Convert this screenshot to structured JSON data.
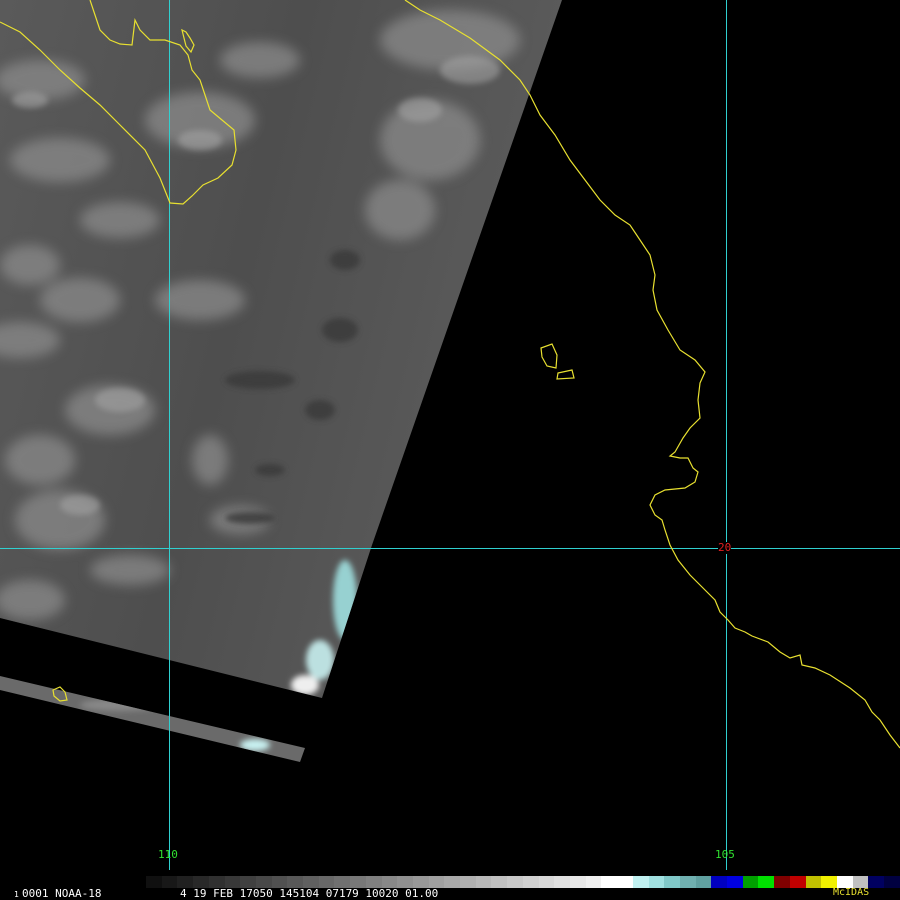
{
  "image_label": "1",
  "satellite": "0001 NOAA-18",
  "status_line": "4 19 FEB 17050 145104 07179 10020 01.00",
  "brand": "McIDAS",
  "grid_labels": {
    "lon_110": "110",
    "lon_105": "105",
    "lat_20": "20"
  },
  "colors": {
    "coastline": "#e8e030",
    "gridline": "#30d0d0",
    "lon_label": "#30e030",
    "lat_label": "#e02020",
    "brand": "#e8e030",
    "background": "#000000"
  },
  "colorbar_stops": [
    "#101010",
    "#181818",
    "#202020",
    "#282828",
    "#303030",
    "#383838",
    "#404040",
    "#484848",
    "#505050",
    "#585858",
    "#606060",
    "#686868",
    "#707070",
    "#787878",
    "#808080",
    "#888888",
    "#909090",
    "#989898",
    "#a0a0a0",
    "#a8a8a8",
    "#b0b0b0",
    "#b8b8b8",
    "#c0c0c0",
    "#c8c8c8",
    "#d0d0d0",
    "#d8d8d8",
    "#e0e0e0",
    "#e8e8e8",
    "#f0f0f0",
    "#ffffff",
    "#ffffff",
    "#c0f0f0",
    "#a0e0e0",
    "#80c8c8",
    "#70b0b0",
    "#60a0a0",
    "#0000c0",
    "#0000e0",
    "#00a000",
    "#00e000",
    "#800000",
    "#c00000",
    "#c0c000",
    "#f0f000",
    "#ffffff",
    "#c0c0c0",
    "#000060",
    "#000040"
  ]
}
